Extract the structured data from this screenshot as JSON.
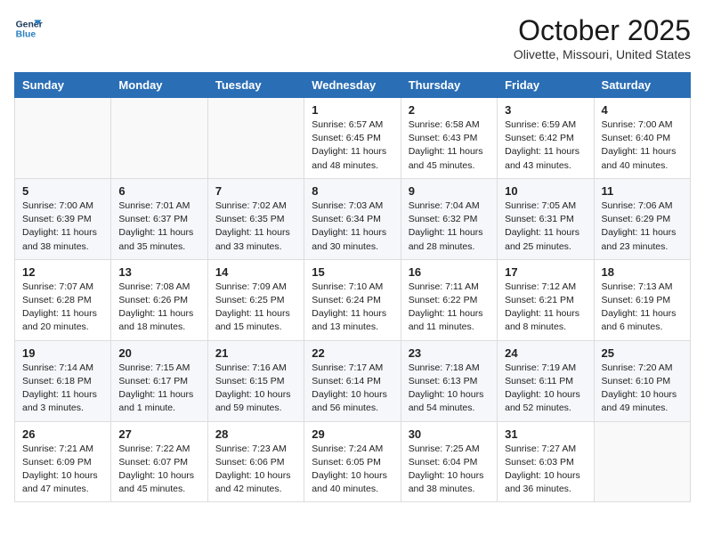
{
  "header": {
    "logo_line1": "General",
    "logo_line2": "Blue",
    "month": "October 2025",
    "location": "Olivette, Missouri, United States"
  },
  "days_of_week": [
    "Sunday",
    "Monday",
    "Tuesday",
    "Wednesday",
    "Thursday",
    "Friday",
    "Saturday"
  ],
  "weeks": [
    [
      {
        "day": "",
        "info": ""
      },
      {
        "day": "",
        "info": ""
      },
      {
        "day": "",
        "info": ""
      },
      {
        "day": "1",
        "info": "Sunrise: 6:57 AM\nSunset: 6:45 PM\nDaylight: 11 hours\nand 48 minutes."
      },
      {
        "day": "2",
        "info": "Sunrise: 6:58 AM\nSunset: 6:43 PM\nDaylight: 11 hours\nand 45 minutes."
      },
      {
        "day": "3",
        "info": "Sunrise: 6:59 AM\nSunset: 6:42 PM\nDaylight: 11 hours\nand 43 minutes."
      },
      {
        "day": "4",
        "info": "Sunrise: 7:00 AM\nSunset: 6:40 PM\nDaylight: 11 hours\nand 40 minutes."
      }
    ],
    [
      {
        "day": "5",
        "info": "Sunrise: 7:00 AM\nSunset: 6:39 PM\nDaylight: 11 hours\nand 38 minutes."
      },
      {
        "day": "6",
        "info": "Sunrise: 7:01 AM\nSunset: 6:37 PM\nDaylight: 11 hours\nand 35 minutes."
      },
      {
        "day": "7",
        "info": "Sunrise: 7:02 AM\nSunset: 6:35 PM\nDaylight: 11 hours\nand 33 minutes."
      },
      {
        "day": "8",
        "info": "Sunrise: 7:03 AM\nSunset: 6:34 PM\nDaylight: 11 hours\nand 30 minutes."
      },
      {
        "day": "9",
        "info": "Sunrise: 7:04 AM\nSunset: 6:32 PM\nDaylight: 11 hours\nand 28 minutes."
      },
      {
        "day": "10",
        "info": "Sunrise: 7:05 AM\nSunset: 6:31 PM\nDaylight: 11 hours\nand 25 minutes."
      },
      {
        "day": "11",
        "info": "Sunrise: 7:06 AM\nSunset: 6:29 PM\nDaylight: 11 hours\nand 23 minutes."
      }
    ],
    [
      {
        "day": "12",
        "info": "Sunrise: 7:07 AM\nSunset: 6:28 PM\nDaylight: 11 hours\nand 20 minutes."
      },
      {
        "day": "13",
        "info": "Sunrise: 7:08 AM\nSunset: 6:26 PM\nDaylight: 11 hours\nand 18 minutes."
      },
      {
        "day": "14",
        "info": "Sunrise: 7:09 AM\nSunset: 6:25 PM\nDaylight: 11 hours\nand 15 minutes."
      },
      {
        "day": "15",
        "info": "Sunrise: 7:10 AM\nSunset: 6:24 PM\nDaylight: 11 hours\nand 13 minutes."
      },
      {
        "day": "16",
        "info": "Sunrise: 7:11 AM\nSunset: 6:22 PM\nDaylight: 11 hours\nand 11 minutes."
      },
      {
        "day": "17",
        "info": "Sunrise: 7:12 AM\nSunset: 6:21 PM\nDaylight: 11 hours\nand 8 minutes."
      },
      {
        "day": "18",
        "info": "Sunrise: 7:13 AM\nSunset: 6:19 PM\nDaylight: 11 hours\nand 6 minutes."
      }
    ],
    [
      {
        "day": "19",
        "info": "Sunrise: 7:14 AM\nSunset: 6:18 PM\nDaylight: 11 hours\nand 3 minutes."
      },
      {
        "day": "20",
        "info": "Sunrise: 7:15 AM\nSunset: 6:17 PM\nDaylight: 11 hours\nand 1 minute."
      },
      {
        "day": "21",
        "info": "Sunrise: 7:16 AM\nSunset: 6:15 PM\nDaylight: 10 hours\nand 59 minutes."
      },
      {
        "day": "22",
        "info": "Sunrise: 7:17 AM\nSunset: 6:14 PM\nDaylight: 10 hours\nand 56 minutes."
      },
      {
        "day": "23",
        "info": "Sunrise: 7:18 AM\nSunset: 6:13 PM\nDaylight: 10 hours\nand 54 minutes."
      },
      {
        "day": "24",
        "info": "Sunrise: 7:19 AM\nSunset: 6:11 PM\nDaylight: 10 hours\nand 52 minutes."
      },
      {
        "day": "25",
        "info": "Sunrise: 7:20 AM\nSunset: 6:10 PM\nDaylight: 10 hours\nand 49 minutes."
      }
    ],
    [
      {
        "day": "26",
        "info": "Sunrise: 7:21 AM\nSunset: 6:09 PM\nDaylight: 10 hours\nand 47 minutes."
      },
      {
        "day": "27",
        "info": "Sunrise: 7:22 AM\nSunset: 6:07 PM\nDaylight: 10 hours\nand 45 minutes."
      },
      {
        "day": "28",
        "info": "Sunrise: 7:23 AM\nSunset: 6:06 PM\nDaylight: 10 hours\nand 42 minutes."
      },
      {
        "day": "29",
        "info": "Sunrise: 7:24 AM\nSunset: 6:05 PM\nDaylight: 10 hours\nand 40 minutes."
      },
      {
        "day": "30",
        "info": "Sunrise: 7:25 AM\nSunset: 6:04 PM\nDaylight: 10 hours\nand 38 minutes."
      },
      {
        "day": "31",
        "info": "Sunrise: 7:27 AM\nSunset: 6:03 PM\nDaylight: 10 hours\nand 36 minutes."
      },
      {
        "day": "",
        "info": ""
      }
    ]
  ]
}
